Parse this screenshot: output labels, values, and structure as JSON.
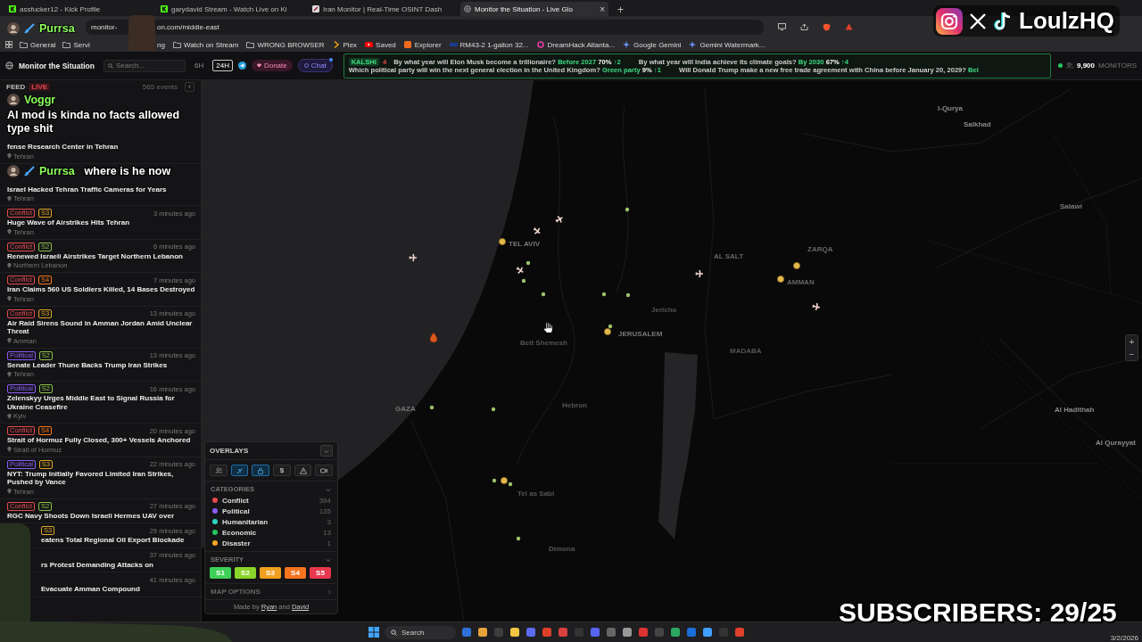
{
  "browser": {
    "tabs": [
      {
        "title": "assfucker12 - Kick Profile",
        "selected": false,
        "kind": "kick"
      },
      {
        "title": "garydavid Stream - Watch Live on Ki",
        "selected": false,
        "kind": "kick"
      },
      {
        "title": "Iran Monitor | Real-Time OSINT Dash",
        "selected": false,
        "kind": "site"
      },
      {
        "title": "Monitor the Situation - Live Glo",
        "selected": true,
        "kind": "globe"
      }
    ],
    "close_tab": "×",
    "new_tab": "+",
    "address": {
      "start": "monitor-",
      "end": "on.com/middle-east"
    },
    "bookmarks": [
      {
        "label": "General",
        "kind": "folder"
      },
      {
        "label": "Servi",
        "kind": "folder"
      },
      {
        "label": "ng",
        "kind": "fragment"
      },
      {
        "label": "Watch on Stream",
        "kind": "folder"
      },
      {
        "label": "WRONG BROWSER",
        "kind": "folder"
      },
      {
        "label": "Plex",
        "kind": "chevron"
      },
      {
        "label": "Saved",
        "kind": "play"
      },
      {
        "label": "Explorer",
        "kind": "square"
      },
      {
        "label": "RM43-2 1-gallon 32...",
        "kind": "flag"
      },
      {
        "label": "DreamHack Atlanta...",
        "kind": "ring"
      },
      {
        "label": "Google Gemini",
        "kind": "star"
      },
      {
        "label": "Gemini Watermark...",
        "kind": "star"
      }
    ]
  },
  "app": {
    "title": "Monitor the Situation",
    "search_placeholder": "Search...",
    "ranges": [
      {
        "label": "6H",
        "selected": false
      },
      {
        "label": "24H",
        "selected": true
      }
    ],
    "donate": "Donate",
    "chat": "Chat",
    "ticker": {
      "source": "KALSHI",
      "count": "4",
      "markets": [
        {
          "question": "By what year will Elon Musk become a trillionaire?",
          "answer": "Before 2027",
          "percent": "70%",
          "change": "↑2"
        },
        {
          "question": "By what year will India achieve its climate goals?",
          "answer": "By 2030",
          "percent": "67%",
          "change": "↑4"
        },
        {
          "question": "Which political party will win the next general election in the United Kingdom?",
          "answer": "Green party",
          "percent": "9%",
          "change": "↑1"
        },
        {
          "question": "Will Donald Trump make a new free trade agreement with China before January 20, 2029?",
          "answer": "Bel"
        }
      ]
    },
    "monitors": {
      "count": "9,900",
      "label": "MONITORS"
    }
  },
  "feed": {
    "title": "FEED",
    "live": "LIVE",
    "count": "565 events",
    "collapse": "‹",
    "items": [
      {
        "kind": "no-meta",
        "title": "fense Research Center in Tehran",
        "location": "Tehran"
      },
      {
        "kind": "no-meta",
        "title": "Israel Hacked Tehran Traffic Cameras for Years",
        "location": "Tehran"
      },
      {
        "kind": "full",
        "category": {
          "label": "Conflict",
          "color": "#e5484d"
        },
        "severity": {
          "label": "S3",
          "color": "#e0a526"
        },
        "time": "3 minutes ago",
        "title": "Huge Wave of Airstrikes Hits Tehran",
        "location": "Tehran"
      },
      {
        "kind": "full",
        "category": {
          "label": "Conflict",
          "color": "#e5484d"
        },
        "severity": {
          "label": "S2",
          "color": "#8bc34a"
        },
        "time": "6 minutes ago",
        "title": "Renewed Israeli Airstrikes Target Northern Lebanon",
        "location": "Northern Lebanon"
      },
      {
        "kind": "full",
        "category": {
          "label": "Conflict",
          "color": "#e5484d"
        },
        "severity": {
          "label": "S4",
          "color": "#f97316"
        },
        "time": "7 minutes ago",
        "title": "Iran Claims 560 US Soldiers Killed, 14 Bases Destroyed",
        "location": "Tehran"
      },
      {
        "kind": "full",
        "category": {
          "label": "Conflict",
          "color": "#e5484d"
        },
        "severity": {
          "label": "S3",
          "color": "#e0a526"
        },
        "time": "13 minutes ago",
        "title": "Air Raid Sirens Sound in Amman Jordan Amid Unclear Threat",
        "location": "Amman"
      },
      {
        "kind": "full",
        "category": {
          "label": "Political",
          "color": "#8b5cf6"
        },
        "severity": {
          "label": "S2",
          "color": "#8bc34a"
        },
        "time": "13 minutes ago",
        "title": "Senate Leader Thune Backs Trump Iran Strikes",
        "location": "Tehran"
      },
      {
        "kind": "full",
        "category": {
          "label": "Political",
          "color": "#8b5cf6"
        },
        "severity": {
          "label": "S2",
          "color": "#8bc34a"
        },
        "time": "16 minutes ago",
        "title": "Zelenskyy Urges Middle East to Signal Russia for Ukraine Ceasefire",
        "location": "Kyiv"
      },
      {
        "kind": "full",
        "category": {
          "label": "Conflict",
          "color": "#e5484d"
        },
        "severity": {
          "label": "S4",
          "color": "#f97316"
        },
        "time": "20 minutes ago",
        "title": "Strait of Hormuz Fully Closed, 300+ Vessels Anchored",
        "location": "Strait of Hormuz"
      },
      {
        "kind": "full",
        "category": {
          "label": "Political",
          "color": "#8b5cf6"
        },
        "severity": {
          "label": "S3",
          "color": "#e0a526"
        },
        "time": "22 minutes ago",
        "title": "NYT: Trump Initially Favored Limited Iran Strikes, Pushed by Vance",
        "location": "Tehran"
      },
      {
        "kind": "full",
        "category": {
          "label": "Conflict",
          "color": "#e5484d"
        },
        "severity": {
          "label": "S2",
          "color": "#8bc34a"
        },
        "time": "27 minutes ago",
        "title": "RGC Navy Shoots Down Israeli Hermes UAV over"
      },
      {
        "kind": "cut",
        "severity": {
          "label": "S3",
          "color": "#e0a526"
        },
        "time": "29 minutes ago",
        "title": "eatens Total Regional Oil Export Blockade"
      },
      {
        "kind": "cut",
        "time": "37 minutes ago",
        "title": "rs Protest Demanding Attacks on"
      },
      {
        "kind": "cut",
        "time": "41 minutes ago",
        "title": "Evacuate Amman Compound"
      }
    ]
  },
  "map": {
    "labels": [
      "l-Qurya",
      "Salkhad",
      "Salawi",
      "Al Hadithah",
      "Al Qurayyat",
      "TEL AVIV",
      "JERUSALEM",
      "AL SALT",
      "ZARQA",
      "AMMAN",
      "GAZA",
      "MADABA",
      "Jericho",
      "Hebron",
      "Beit Shemesh",
      "Tel as Sabi",
      "Dimona"
    ],
    "zoom_in": "+",
    "zoom_out": "−"
  },
  "overlays": {
    "title": "OVERLAYS",
    "layers": [
      {
        "kind": "people",
        "selected": false
      },
      {
        "kind": "plane",
        "selected": true
      },
      {
        "kind": "bag",
        "selected": true
      },
      {
        "kind": "dollar",
        "label": "$",
        "selected": false
      },
      {
        "kind": "warning",
        "selected": false
      },
      {
        "kind": "camera",
        "selected": false
      }
    ],
    "categories": {
      "title": "CATEGORIES",
      "items": [
        {
          "label": "Conflict",
          "count": "394",
          "color": "#e5484d"
        },
        {
          "label": "Political",
          "count": "135",
          "color": "#8b5cf6"
        },
        {
          "label": "Humanitarian",
          "count": "3",
          "color": "#2dd4bf"
        },
        {
          "label": "Economic",
          "count": "13",
          "color": "#22c55e"
        },
        {
          "label": "Disaster",
          "count": "1",
          "color": "#f5a524"
        }
      ]
    },
    "severity": {
      "title": "SEVERITY",
      "levels": [
        {
          "label": "S1",
          "color": "#3fd058"
        },
        {
          "label": "S2",
          "color": "#8ad42a"
        },
        {
          "label": "S3",
          "color": "#f0a020"
        },
        {
          "label": "S4",
          "color": "#f47420"
        },
        {
          "label": "S5",
          "color": "#e8384f"
        }
      ]
    },
    "map_options": "MAP OPTIONS",
    "credit": {
      "before": "Made by",
      "first": "Ryan",
      "middle": "and",
      "second": "David"
    }
  },
  "taskbar": {
    "search": "Search",
    "date": "3/2/2026"
  },
  "stream": {
    "chat": [
      {
        "user": "Purrsa",
        "badge": true
      },
      {
        "user": "Voggr",
        "badge": false,
        "message": "AI mod is kinda no facts allowed type shit"
      },
      {
        "user": "Purrsa",
        "badge": true,
        "message": "where is he now"
      }
    ],
    "social": {
      "handle": "LoulzHQ"
    },
    "subscribers": "SUBSCRIBERS: 29/25"
  }
}
